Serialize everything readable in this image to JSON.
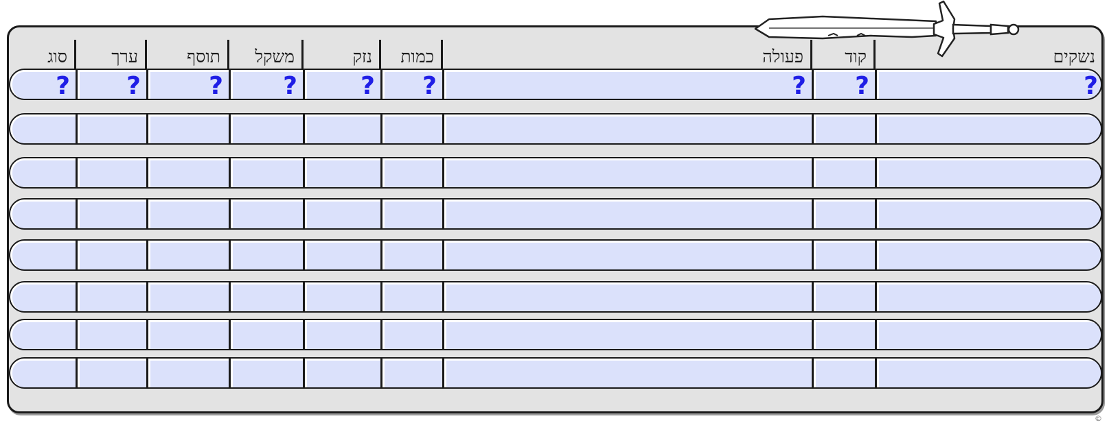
{
  "sheet": {
    "columns": [
      {
        "key": "type",
        "label": "סוג"
      },
      {
        "key": "value",
        "label": "ערך"
      },
      {
        "key": "bonus",
        "label": "תוסף"
      },
      {
        "key": "weight",
        "label": "משקל"
      },
      {
        "key": "damage",
        "label": "נזק"
      },
      {
        "key": "quantity",
        "label": "כמות"
      },
      {
        "key": "action",
        "label": "פעולה"
      },
      {
        "key": "code",
        "label": "קוד"
      },
      {
        "key": "weapons",
        "label": "נשקים"
      }
    ],
    "help_mark": "?",
    "row_count": 8,
    "help_row_index": 0,
    "colors": {
      "panel": "#e3e3e3",
      "field": "#dbe1fb",
      "border": "#1a1a1a",
      "help": "#1f1ee6"
    },
    "decoration": "sword-icon",
    "footer_symbol": "©"
  }
}
